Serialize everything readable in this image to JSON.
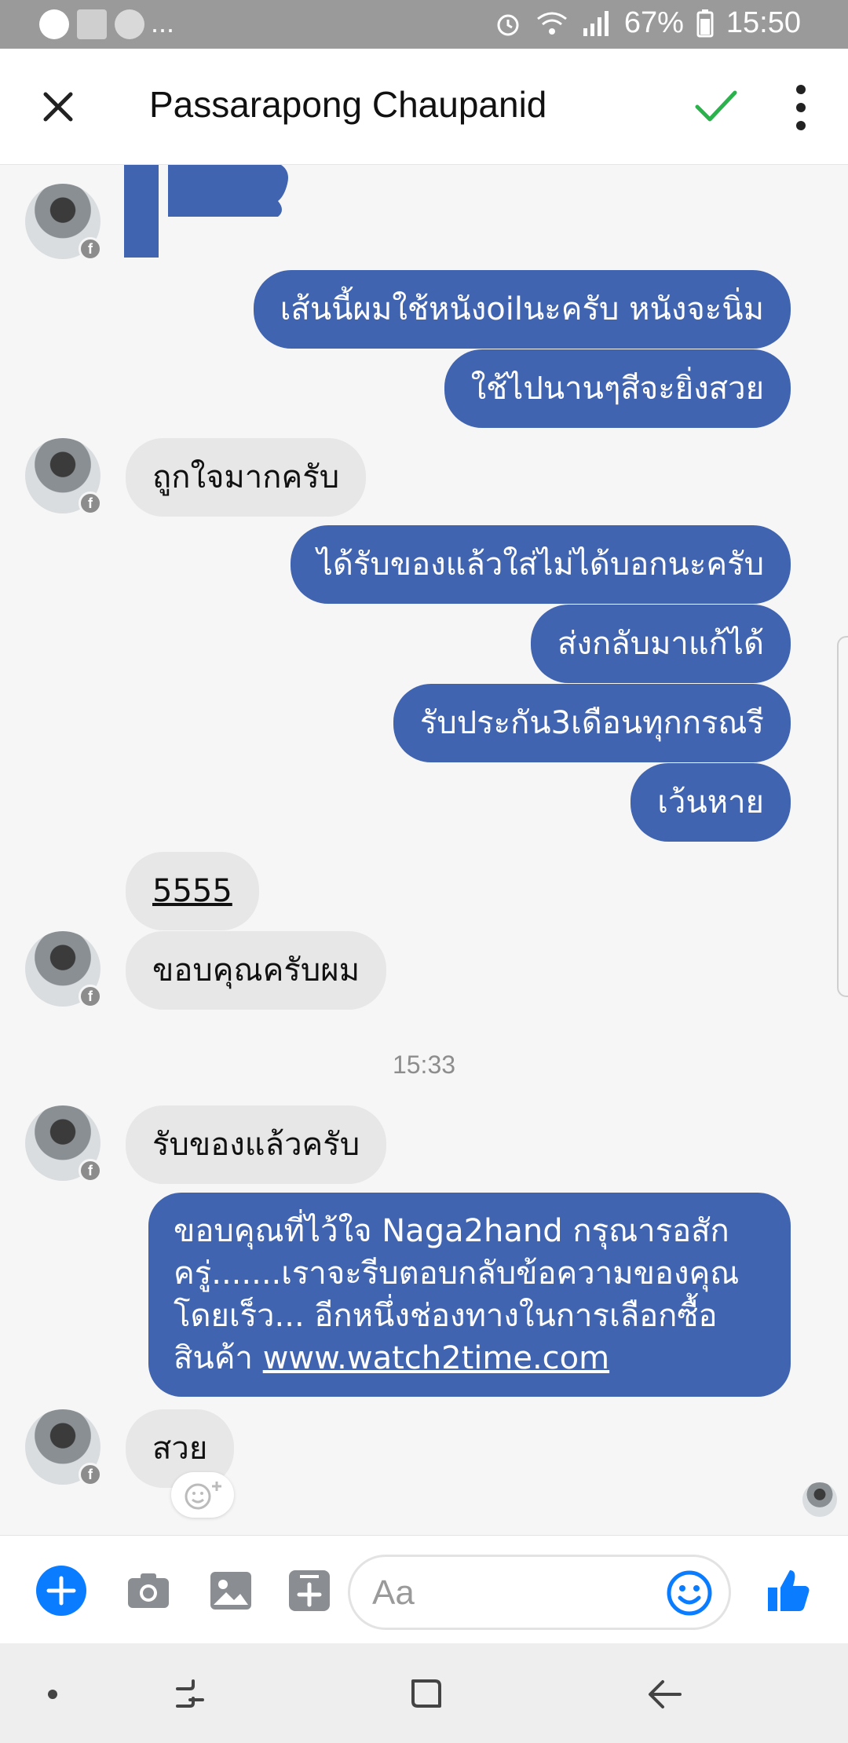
{
  "status_bar": {
    "dots": "...",
    "battery": "67%",
    "time": "15:50"
  },
  "header": {
    "title": "Passarapong Chaupanid"
  },
  "messages": {
    "m1": "เส้นนี้ผมใช้หนังoilนะครับ หนังจะนิ่ม",
    "m2": "ใช้ไปนานๆสีจะยิ่งสวย",
    "m3": "ถูกใจมากครับ",
    "m4": "ได้รับของแล้วใส่ไม่ได้บอกนะครับ",
    "m5": "ส่งกลับมาแก้ได้",
    "m6": "รับประกัน3เดือนทุกกรณรี",
    "m7": "เว้นหาย",
    "m8": "5555",
    "m9": "ขอบคุณครับผม",
    "timestamp": "15:33",
    "m10": "รับของแล้วครับ",
    "m11_text": "ขอบคุณที่ไว้ใจ Naga2hand กรุณารอสักครู่.......เราจะรีบตอบกลับข้อความของคุณโดยเร็ว... อีกหนึ่งช่องทางในการเลือกซื้อสินค้า ",
    "m11_link": "www.watch2time.com",
    "m12": "สวย"
  },
  "composer": {
    "placeholder": "Aa"
  },
  "colors": {
    "outgoing_bubble": "#4164b0",
    "incoming_bubble": "#e7e7e7",
    "messenger_blue": "#0a7cff",
    "check_green": "#2bb24c"
  }
}
